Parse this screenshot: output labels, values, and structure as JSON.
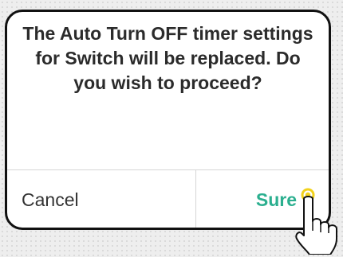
{
  "dialog": {
    "message": "The Auto Turn OFF timer settings for Switch will be replaced. Do you wish to proceed?",
    "cancel_label": "Cancel",
    "confirm_label": "Sure"
  },
  "colors": {
    "confirm_accent": "#2baf8f",
    "tap_indicator": "#f2d21b",
    "dialog_border": "#111111"
  },
  "icons": {
    "pointer": "pointing-hand-icon"
  }
}
